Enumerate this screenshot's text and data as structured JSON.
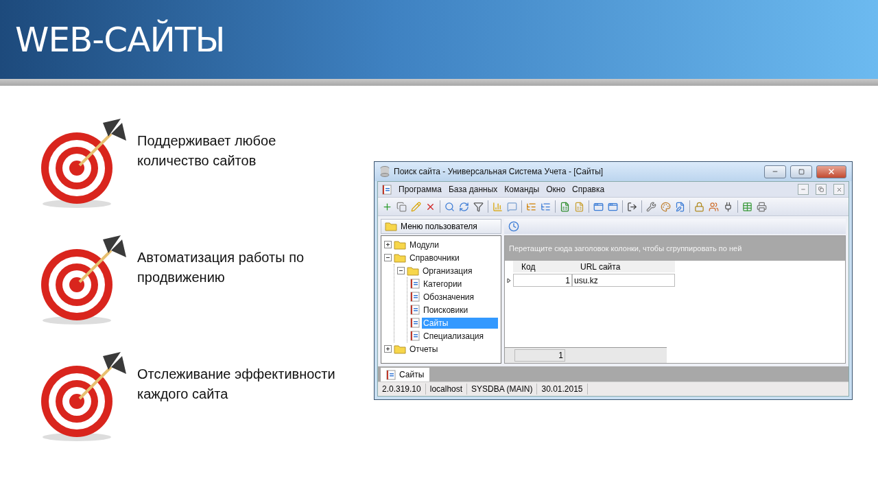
{
  "slide_title": "WEB-САЙТЫ",
  "bullets": [
    "Поддерживает любое количество сайтов",
    "Автоматизация работы по продвижению",
    "Отслеживание эффективности каждого сайта"
  ],
  "window": {
    "title": "Поиск сайта - Универсальная Система Учета - [Сайты]",
    "menu": [
      "Программа",
      "База данных",
      "Команды",
      "Окно",
      "Справка"
    ],
    "side_panel": {
      "title": "Меню пользователя",
      "tree": [
        {
          "label": "Модули",
          "expanded": false,
          "selected": false
        },
        {
          "label": "Справочники",
          "expanded": true,
          "selected": false,
          "children": [
            {
              "label": "Организация",
              "expanded": true,
              "selected": false,
              "children": [
                {
                  "label": "Категории",
                  "selected": false
                },
                {
                  "label": "Обозначения",
                  "selected": false
                },
                {
                  "label": "Поисковики",
                  "selected": false
                },
                {
                  "label": "Сайты",
                  "selected": true
                },
                {
                  "label": "Специализация",
                  "selected": false
                }
              ]
            }
          ]
        },
        {
          "label": "Отчеты",
          "expanded": false,
          "selected": false
        }
      ]
    },
    "grid": {
      "group_hint": "Перетащите сюда заголовок колонки, чтобы сгруппировать по ней",
      "columns": [
        "Код",
        "URL сайта"
      ],
      "rows": [
        [
          "1",
          "usu.kz"
        ]
      ],
      "footer": "1"
    },
    "tabs": [
      {
        "label": "Сайты",
        "selected": true
      }
    ],
    "status_bar": [
      "2.0.319.10",
      "localhost",
      "SYSDBA (MAIN)",
      "30.01.2015"
    ]
  }
}
